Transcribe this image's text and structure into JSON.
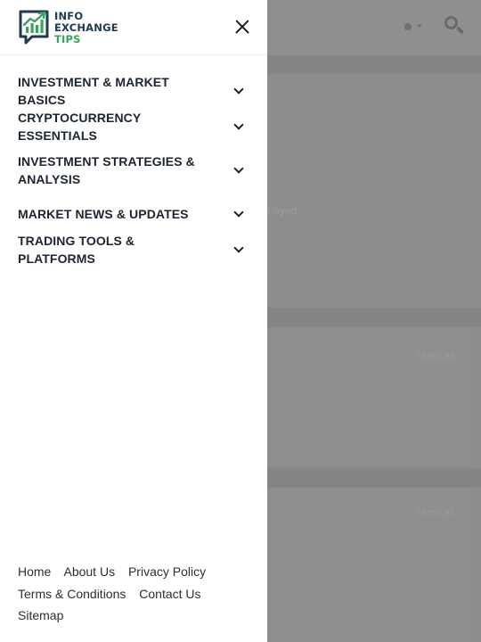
{
  "brand": {
    "line1": "INFO",
    "line2": "EXCHANGE",
    "line3": "TIPS"
  },
  "drawer": {
    "close_icon": "close-icon",
    "menu": [
      {
        "label": "INVESTMENT & MARKET BASICS",
        "icon": "chevron-down-icon"
      },
      {
        "label": "CRYPTOCURRENCY ESSENTIALS",
        "icon": "chevron-down-icon"
      },
      {
        "label": "INVESTMENT STRATEGIES & ANALYSIS",
        "icon": "chevron-down-icon"
      },
      {
        "label": "MARKET NEWS & UPDATES",
        "icon": "chevron-down-icon"
      },
      {
        "label": "TRADING TOOLS & PLATFORMS",
        "icon": "chevron-down-icon"
      }
    ],
    "footer_links": [
      "Home",
      "About Us",
      "Privacy Policy",
      "Terms & Conditions",
      "Contact Us",
      "Sitemap"
    ]
  },
  "background": {
    "fragment_text": "Fayed",
    "view_all_1": "View all",
    "view_all_2": "View all",
    "search_icon": "search-icon",
    "theme_toggle_icon": "theme-toggle-icon"
  },
  "colors": {
    "brand_dark": "#1d3b4f",
    "brand_green": "#3aa35c",
    "overlay": "#8d8d8d"
  }
}
